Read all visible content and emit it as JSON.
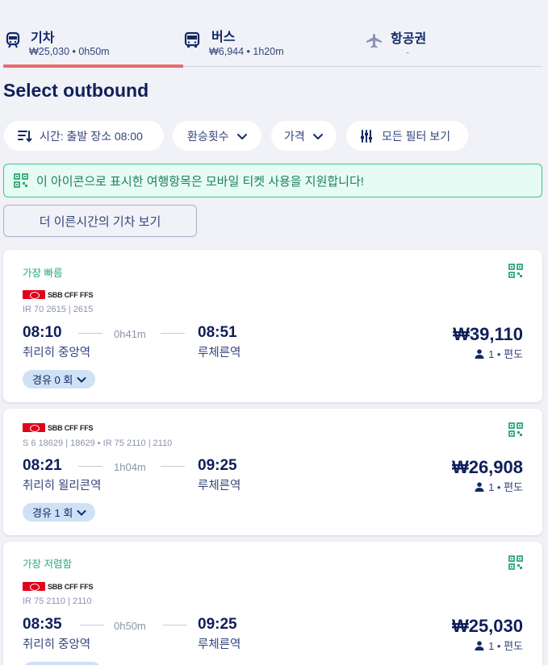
{
  "tabs": [
    {
      "name": "기차",
      "sub": "₩25,030 • 0h50m",
      "icon": "train-icon",
      "active": true
    },
    {
      "name": "버스",
      "sub": "₩6,944 • 1h20m",
      "icon": "bus-icon",
      "active": false
    },
    {
      "name": "항공권",
      "sub": "-",
      "icon": "airplane-icon",
      "active": false
    }
  ],
  "page": {
    "heading": "Select outbound"
  },
  "filters": {
    "time": "시간: 출발 장소 08:00",
    "transfers": "환승횟수",
    "price": "가격",
    "all_filters": "모든 필터 보기"
  },
  "notice": {
    "text": "이 아이콘으로 표시한 여행항목은 모바일 티켓 사용을 지원합니다!",
    "icon": "qr-code-icon"
  },
  "earlier_button": "더 이른시간의 기차 보기",
  "results": [
    {
      "badge": "가장 빠름",
      "operator": "SBB CFF FFS",
      "train_no": "IR 70 2615 | 2615",
      "dep_time": "08:10",
      "dep_station": "취리히 중앙역",
      "duration": "0h41m",
      "arr_time": "08:51",
      "arr_station": "루체른역",
      "price": "₩39,110",
      "pax": "1 • 편도",
      "stops": "경유 0 회"
    },
    {
      "badge": "",
      "operator": "SBB CFF FFS",
      "train_no": "S 6 18629 | 18629 • IR 75 2110 | 2110",
      "dep_time": "08:21",
      "dep_station": "취리히 욀리콘역",
      "duration": "1h04m",
      "arr_time": "09:25",
      "arr_station": "루체른역",
      "price": "₩26,908",
      "pax": "1 • 편도",
      "stops": "경유 1 회"
    },
    {
      "badge": "가장 저렴함",
      "operator": "SBB CFF FFS",
      "train_no": "IR 75 2110 | 2110",
      "dep_time": "08:35",
      "dep_station": "취리히 중앙역",
      "duration": "0h50m",
      "arr_time": "09:25",
      "arr_station": "루체른역",
      "price": "₩25,030",
      "pax": "1 • 편도",
      "stops": ""
    }
  ],
  "colors": {
    "accent_underline": "#e86a6a",
    "notice_green": "#36c592",
    "brand_red": "#e2001a",
    "navy": "#0f1f5a"
  }
}
